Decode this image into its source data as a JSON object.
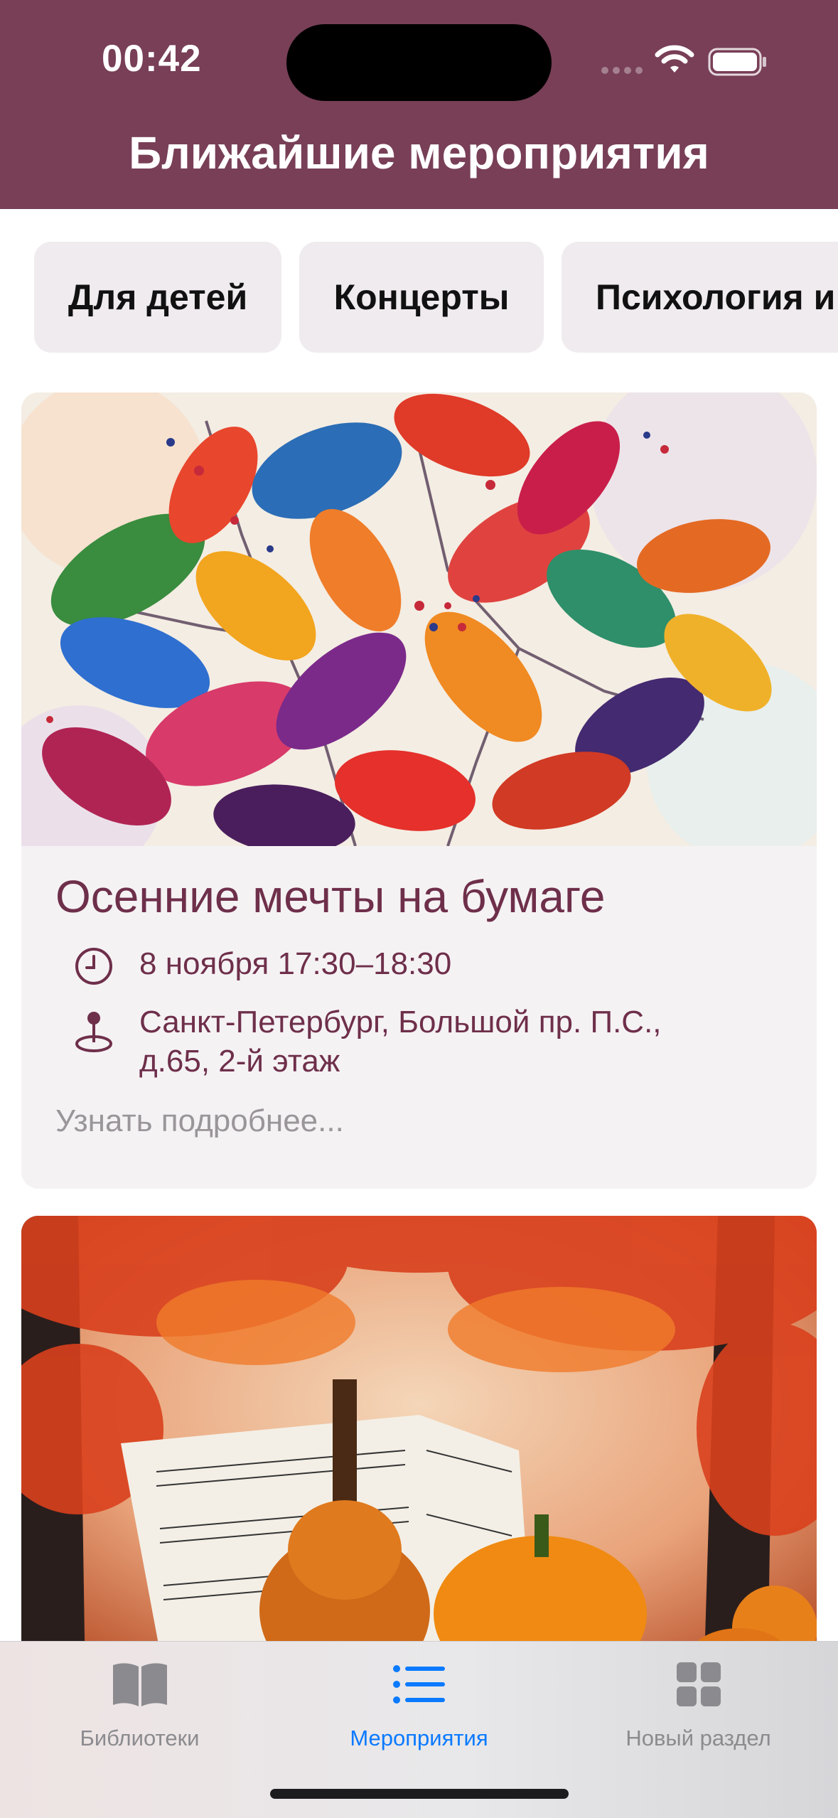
{
  "status_bar": {
    "time": "00:42"
  },
  "header": {
    "title": "Ближайшие мероприятия",
    "background": "#783f57"
  },
  "categories": [
    "Для детей",
    "Концерты",
    "Психология и"
  ],
  "events": [
    {
      "title": "Осенние мечты на бумаге",
      "datetime": "8 ноября 17:30–18:30",
      "address": "Санкт-Петербург, Большой пр. П.С., д.65, 2-й этаж",
      "more": "Узнать подробнее...",
      "image_icon": "autumn-leaves-watercolor-image"
    },
    {
      "image_icon": "autumn-violin-concert-image"
    }
  ],
  "tabbar": {
    "items": [
      {
        "label": "Библиотеки",
        "icon": "book-icon",
        "active": false
      },
      {
        "label": "Мероприятия",
        "icon": "list-icon",
        "active": true
      },
      {
        "label": "Новый раздел",
        "icon": "grid-icon",
        "active": false
      }
    ]
  },
  "colors": {
    "accent": "#0a7aff",
    "brand": "#783f57",
    "event_text": "#6e2f4a"
  }
}
